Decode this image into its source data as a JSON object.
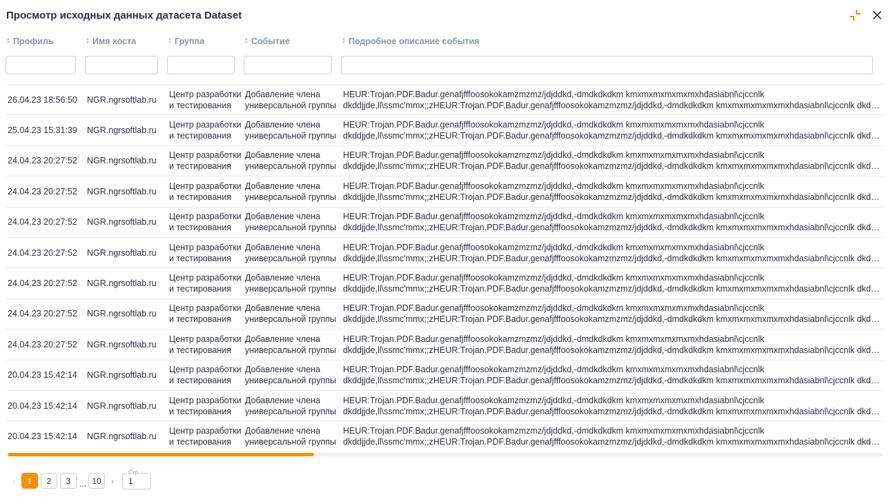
{
  "dialog": {
    "title": "Просмотр исходных данных датасета Dataset"
  },
  "columns": [
    {
      "label": "Профиль"
    },
    {
      "label": "Имя хоста"
    },
    {
      "label": "Группа"
    },
    {
      "label": "Событие"
    },
    {
      "label": "Подробное описание события"
    }
  ],
  "filters": {
    "profile": "",
    "host": "",
    "group": "",
    "event": "",
    "description": ""
  },
  "rows": [
    {
      "profile": "26.04.23 18:56:50",
      "host": "NGR.ngrsoftlab.ru",
      "group_1": "Центр разработки",
      "group_2": "и тестирования",
      "event_1": "Добавление члена",
      "event_2": "универсальной группы",
      "desc_1": "HEUR:Trojan.PDF.Badur.genafjfffoosokokamzmzmz/jdjddkd,-dmdkdkdkm kmxmxmxmxmxmxhdasiabnl\\cjccnlk",
      "desc_2": "dkddjjde,ll\\ssmc'mmx;;zHEUR:Trojan.PDF.Badur.genafjfffoosokokamzmzmz/jdjddkd,-dmdkdkdkm kmxmxmxmxmxmxhdasiabnl\\cjccnlk dkddjjde,ll\\ss..."
    },
    {
      "profile": "25.04.23 15:31:39",
      "host": "NGR.ngrsoftlab.ru",
      "group_1": "Центр разработки",
      "group_2": "и тестирования",
      "event_1": "Добавление члена",
      "event_2": "универсальной группы",
      "desc_1": "HEUR:Trojan.PDF.Badur.genafjfffoosokokamzmzmz/jdjddkd,-dmdkdkdkm kmxmxmxmxmxmxhdasiabnl\\cjccnlk",
      "desc_2": "dkddjjde,ll\\ssmc'mmx;;zHEUR:Trojan.PDF.Badur.genafjfffoosokokamzmzmz/jdjddkd,-dmdkdkdkm kmxmxmxmxmxmxhdasiabnl\\cjccnlk dkddjjde,ll\\ss..."
    },
    {
      "profile": "24.04.23 20:27:52",
      "host": "NGR.ngrsoftlab.ru",
      "group_1": "Центр разработки",
      "group_2": "и тестирования",
      "event_1": "Добавление члена",
      "event_2": "универсальной группы",
      "desc_1": "HEUR:Trojan.PDF.Badur.genafjfffoosokokamzmzmz/jdjddkd,-dmdkdkdkm kmxmxmxmxmxmxhdasiabnl\\cjccnlk",
      "desc_2": "dkddjjde,ll\\ssmc'mmx;;zHEUR:Trojan.PDF.Badur.genafjfffoosokokamzmzmz/jdjddkd,-dmdkdkdkm kmxmxmxmxmxmxhdasiabnl\\cjccnlk dkddjjde,ll\\ss..."
    },
    {
      "profile": "24.04.23 20:27:52",
      "host": "NGR.ngrsoftlab.ru",
      "group_1": "Центр разработки",
      "group_2": "и тестирования",
      "event_1": "Добавление члена",
      "event_2": "универсальной группы",
      "desc_1": "HEUR:Trojan.PDF.Badur.genafjfffoosokokamzmzmz/jdjddkd,-dmdkdkdkm kmxmxmxmxmxmxhdasiabnl\\cjccnlk",
      "desc_2": "dkddjjde,ll\\ssmc'mmx;;zHEUR:Trojan.PDF.Badur.genafjfffoosokokamzmzmz/jdjddkd,-dmdkdkdkm kmxmxmxmxmxmxhdasiabnl\\cjccnlk dkddjjde,ll\\ss..."
    },
    {
      "profile": "24.04.23 20:27:52",
      "host": "NGR.ngrsoftlab.ru",
      "group_1": "Центр разработки",
      "group_2": "и тестирования",
      "event_1": "Добавление члена",
      "event_2": "универсальной группы",
      "desc_1": "HEUR:Trojan.PDF.Badur.genafjfffoosokokamzmzmz/jdjddkd,-dmdkdkdkm kmxmxmxmxmxmxhdasiabnl\\cjccnlk",
      "desc_2": "dkddjjde,ll\\ssmc'mmx;;zHEUR:Trojan.PDF.Badur.genafjfffoosokokamzmzmz/jdjddkd,-dmdkdkdkm kmxmxmxmxmxmxhdasiabnl\\cjccnlk dkddjjde,ll\\ss..."
    },
    {
      "profile": "24.04.23 20:27:52",
      "host": "NGR.ngrsoftlab.ru",
      "group_1": "Центр разработки",
      "group_2": "и тестирования",
      "event_1": "Добавление члена",
      "event_2": "универсальной группы",
      "desc_1": "HEUR:Trojan.PDF.Badur.genafjfffoosokokamzmzmz/jdjddkd,-dmdkdkdkm kmxmxmxmxmxmxhdasiabnl\\cjccnlk",
      "desc_2": "dkddjjde,ll\\ssmc'mmx;;zHEUR:Trojan.PDF.Badur.genafjfffoosokokamzmzmz/jdjddkd,-dmdkdkdkm kmxmxmxmxmxmxhdasiabnl\\cjccnlk dkddjjde,ll\\ss..."
    },
    {
      "profile": "24.04.23 20:27:52",
      "host": "NGR.ngrsoftlab.ru",
      "group_1": "Центр разработки",
      "group_2": "и тестирования",
      "event_1": "Добавление члена",
      "event_2": "универсальной группы",
      "desc_1": "HEUR:Trojan.PDF.Badur.genafjfffoosokokamzmzmz/jdjddkd,-dmdkdkdkm kmxmxmxmxmxmxhdasiabnl\\cjccnlk",
      "desc_2": "dkddjjde,ll\\ssmc'mmx;;zHEUR:Trojan.PDF.Badur.genafjfffoosokokamzmzmz/jdjddkd,-dmdkdkdkm kmxmxmxmxmxmxhdasiabnl\\cjccnlk dkddjjde,ll\\ss..."
    },
    {
      "profile": "24.04.23 20:27:52",
      "host": "NGR.ngrsoftlab.ru",
      "group_1": "Центр разработки",
      "group_2": "и тестирования",
      "event_1": "Добавление члена",
      "event_2": "универсальной группы",
      "desc_1": "HEUR:Trojan.PDF.Badur.genafjfffoosokokamzmzmz/jdjddkd,-dmdkdkdkm kmxmxmxmxmxmxhdasiabnl\\cjccnlk",
      "desc_2": "dkddjjde,ll\\ssmc'mmx;;zHEUR:Trojan.PDF.Badur.genafjfffoosokokamzmzmz/jdjddkd,-dmdkdkdkm kmxmxmxmxmxmxhdasiabnl\\cjccnlk dkddjjde,ll\\ss..."
    },
    {
      "profile": "24.04.23 20:27:52",
      "host": "NGR.ngrsoftlab.ru",
      "group_1": "Центр разработки",
      "group_2": "и тестирования",
      "event_1": "Добавление члена",
      "event_2": "универсальной группы",
      "desc_1": "HEUR:Trojan.PDF.Badur.genafjfffoosokokamzmzmz/jdjddkd,-dmdkdkdkm kmxmxmxmxmxmxhdasiabnl\\cjccnlk",
      "desc_2": "dkddjjde,ll\\ssmc'mmx;;zHEUR:Trojan.PDF.Badur.genafjfffoosokokamzmzmz/jdjddkd,-dmdkdkdkm kmxmxmxmxmxmxhdasiabnl\\cjccnlk dkddjjde,ll\\ss..."
    },
    {
      "profile": "20.04.23 15:42:14",
      "host": "NGR.ngrsoftlab.ru",
      "group_1": "Центр разработки",
      "group_2": "и тестирования",
      "event_1": "Добавление члена",
      "event_2": "универсальной группы",
      "desc_1": "HEUR:Trojan.PDF.Badur.genafjfffoosokokamzmzmz/jdjddkd,-dmdkdkdkm kmxmxmxmxmxmxhdasiabnl\\cjccnlk",
      "desc_2": "dkddjjde,ll\\ssmc'mmx;;zHEUR:Trojan.PDF.Badur.genafjfffoosokokamzmzmz/jdjddkd,-dmdkdkdkm kmxmxmxmxmxmxhdasiabnl\\cjccnlk dkddjjde,ll\\ss..."
    },
    {
      "profile": "20.04.23 15:42:14",
      "host": "NGR.ngrsoftlab.ru",
      "group_1": "Центр разработки",
      "group_2": "и тестирования",
      "event_1": "Добавление члена",
      "event_2": "универсальной группы",
      "desc_1": "HEUR:Trojan.PDF.Badur.genafjfffoosokokamzmzmz/jdjddkd,-dmdkdkdkm kmxmxmxmxmxmxhdasiabnl\\cjccnlk",
      "desc_2": "dkddjjde,ll\\ssmc'mmx;;zHEUR:Trojan.PDF.Badur.genafjfffoosokokamzmzmz/jdjddkd,-dmdkdkdkm kmxmxmxmxmxmxhdasiabnl\\cjccnlk dkddjjde,ll\\ss..."
    },
    {
      "profile": "20.04.23 15:42:14",
      "host": "NGR.ngrsoftlab.ru",
      "group_1": "Центр разработки",
      "group_2": "и тестирования",
      "event_1": "Добавление члена",
      "event_2": "универсальной группы",
      "desc_1": "HEUR:Trojan.PDF.Badur.genafjfffoosokokamzmzmz/jdjddkd,-dmdkdkdkm kmxmxmxmxmxmxhdasiabnl\\cjccnlk",
      "desc_2": "dkddjjde,ll\\ssmc'mmx;;zHEUR:Trojan.PDF.Badur.genafjfffoosokokamzmzmz/jdjddkd,-dmdkdkdkm kmxmxmxmxmxmxhdasiabnl\\cjccnlk dkddjjde,ll\\ss..."
    }
  ],
  "pagination": {
    "pages": [
      "1",
      "2",
      "3"
    ],
    "ellipsis": "...",
    "last_page": "10",
    "current": "1",
    "page_input_label": "Стр.",
    "page_input_value": "1"
  },
  "scroll": {
    "horizontal_position_fraction": 0.35
  },
  "colors": {
    "accent": "#f5900a",
    "header_text": "#8a93a3",
    "text": "#2b2f3a",
    "border": "#c9ced8"
  },
  "icons": {
    "collapse": "collapse-icon",
    "close": "close-icon",
    "sort": "sort-icon",
    "prev": "chevron-left-icon",
    "next": "chevron-right-icon"
  }
}
